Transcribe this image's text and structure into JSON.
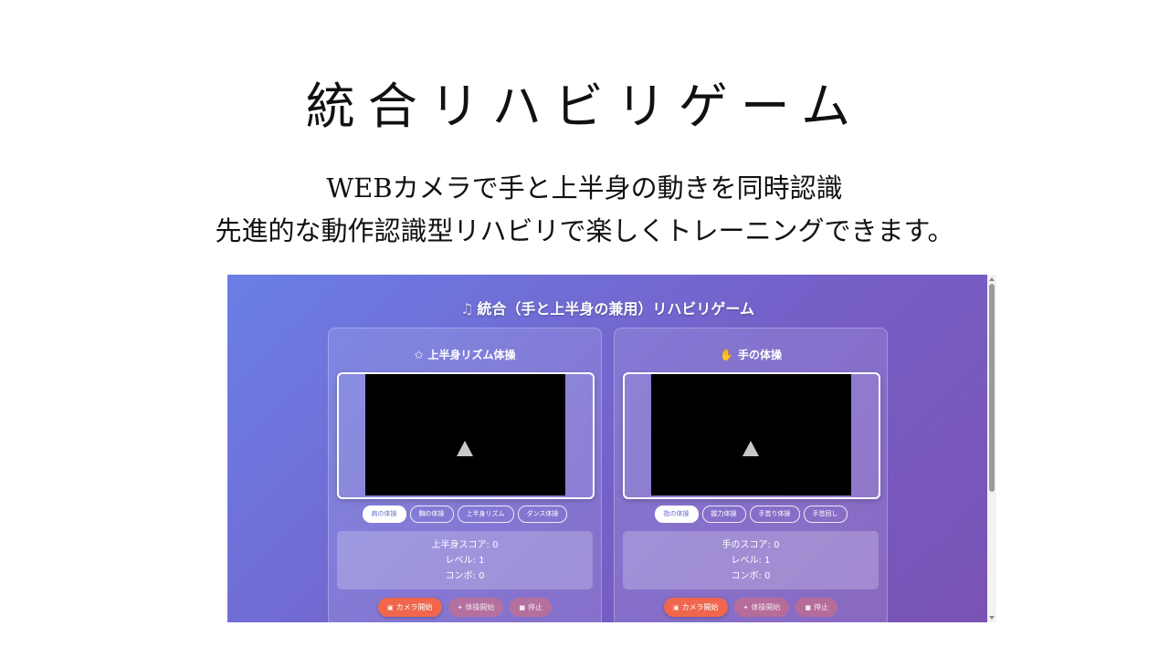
{
  "slide": {
    "title": "統合リハビリゲーム",
    "subtitle_line1": "WEBカメラで手と上半身の動きを同時認識",
    "subtitle_line2": "先進的な動作認識型リハビリで楽しくトレーニングできます。"
  },
  "app": {
    "title_icon": "♫",
    "title": "統合（手と上半身の兼用）リハビリゲーム",
    "panels": [
      {
        "icon": "✩",
        "title": "上半身リズム体操",
        "exercises": [
          "肩の体操",
          "胸の体操",
          "上半身リズム",
          "ダンス体操"
        ],
        "active_exercise": 0,
        "stats": [
          "上半身スコア: 0",
          "レベル: 1",
          "コンボ: 0"
        ],
        "buttons": {
          "camera": "カメラ開始",
          "start": "体操開始",
          "stop": "停止"
        }
      },
      {
        "icon": "✋",
        "title": "手の体操",
        "exercises": [
          "指の体操",
          "握力体操",
          "手首り体操",
          "手首回し"
        ],
        "active_exercise": 0,
        "stats": [
          "手のスコア: 0",
          "レベル: 1",
          "コンボ: 0"
        ],
        "buttons": {
          "camera": "カメラ開始",
          "start": "体操開始",
          "stop": "停止"
        }
      }
    ]
  },
  "icons": {
    "music": "music-note-icon",
    "camera": "camera-icon",
    "start": "exercise-icon",
    "stop": "stop-icon",
    "play": "play-icon"
  },
  "colors": {
    "gradient_start": "#6a7fe6",
    "gradient_end": "#7a52b4",
    "camera_button": "#f0674e"
  }
}
